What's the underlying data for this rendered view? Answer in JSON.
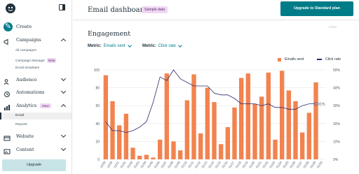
{
  "sidebar": {
    "create_label": "Create",
    "items": [
      {
        "label": "Campaigns"
      },
      {
        "label": "Audience"
      },
      {
        "label": "Automations"
      },
      {
        "label": "Analytics",
        "badge": "New"
      },
      {
        "label": "Website"
      },
      {
        "label": "Content"
      }
    ],
    "campaign_subs": [
      "All campaigns",
      "Campaign Manager",
      "Email templates"
    ],
    "campaign_beta": "Beta",
    "analytics_subs": [
      "Email",
      "Reports"
    ],
    "upgrade_label": "Upgrade"
  },
  "header": {
    "title": "Email dashboard",
    "sample_badge": "Sample data",
    "upgrade_button": "Upgrade to Standard plan"
  },
  "engagement": {
    "title": "Engagement",
    "edit_label": "Editor",
    "metric_label": "Metric:",
    "metric_value": "Emails sent",
    "metric2_label": "Metric:",
    "metric2_value": "Click rate"
  },
  "colors": {
    "accent": "#007c89",
    "bar": "#f2834f",
    "line": "#2d2a6e"
  },
  "chart_data": {
    "type": "bar",
    "x": [
      "12/29",
      "12/30",
      "12/31",
      "01/01",
      "01/02",
      "01/03",
      "01/04",
      "01/05",
      "01/06",
      "01/07",
      "01/08",
      "01/09",
      "01/10",
      "01/11",
      "01/12",
      "01/13",
      "01/14",
      "01/15",
      "01/16",
      "01/17",
      "01/18",
      "01/19",
      "01/20",
      "01/21",
      "01/22",
      "01/23",
      "01/24",
      "01/25",
      "01/26",
      "01/27",
      "01/28",
      "01/29",
      "01/30"
    ],
    "series": [
      {
        "name": "Emails sent",
        "type": "bar",
        "axis": "left",
        "values": [
          94,
          65,
          38,
          51,
          13,
          4,
          5,
          2,
          22,
          96,
          20,
          10,
          66,
          95,
          29,
          80,
          64,
          17,
          36,
          58,
          91,
          96,
          62,
          70,
          97,
          22,
          99,
          77,
          65,
          30,
          52,
          86
        ]
      },
      {
        "name": "Click rate",
        "type": "line",
        "axis": "right",
        "values": [
          21,
          16,
          16,
          15,
          16,
          18,
          21,
          32,
          46,
          44,
          50,
          45,
          43,
          41,
          41,
          41,
          37,
          36,
          36,
          34,
          31,
          31,
          31,
          30,
          31,
          29,
          29,
          28,
          28,
          30,
          31,
          31
        ]
      }
    ],
    "yleft": {
      "ticks": [
        0,
        20,
        40,
        60,
        80,
        100
      ],
      "range": [
        0,
        100
      ]
    },
    "yright": {
      "ticks": [
        "0%",
        "10%",
        "20%",
        "30%",
        "40%",
        "50%"
      ],
      "range": [
        0,
        50
      ]
    },
    "end_label": "31%",
    "legend": [
      "Emails sent",
      "Click rate"
    ],
    "legend_position": "top-right",
    "grid": true
  }
}
